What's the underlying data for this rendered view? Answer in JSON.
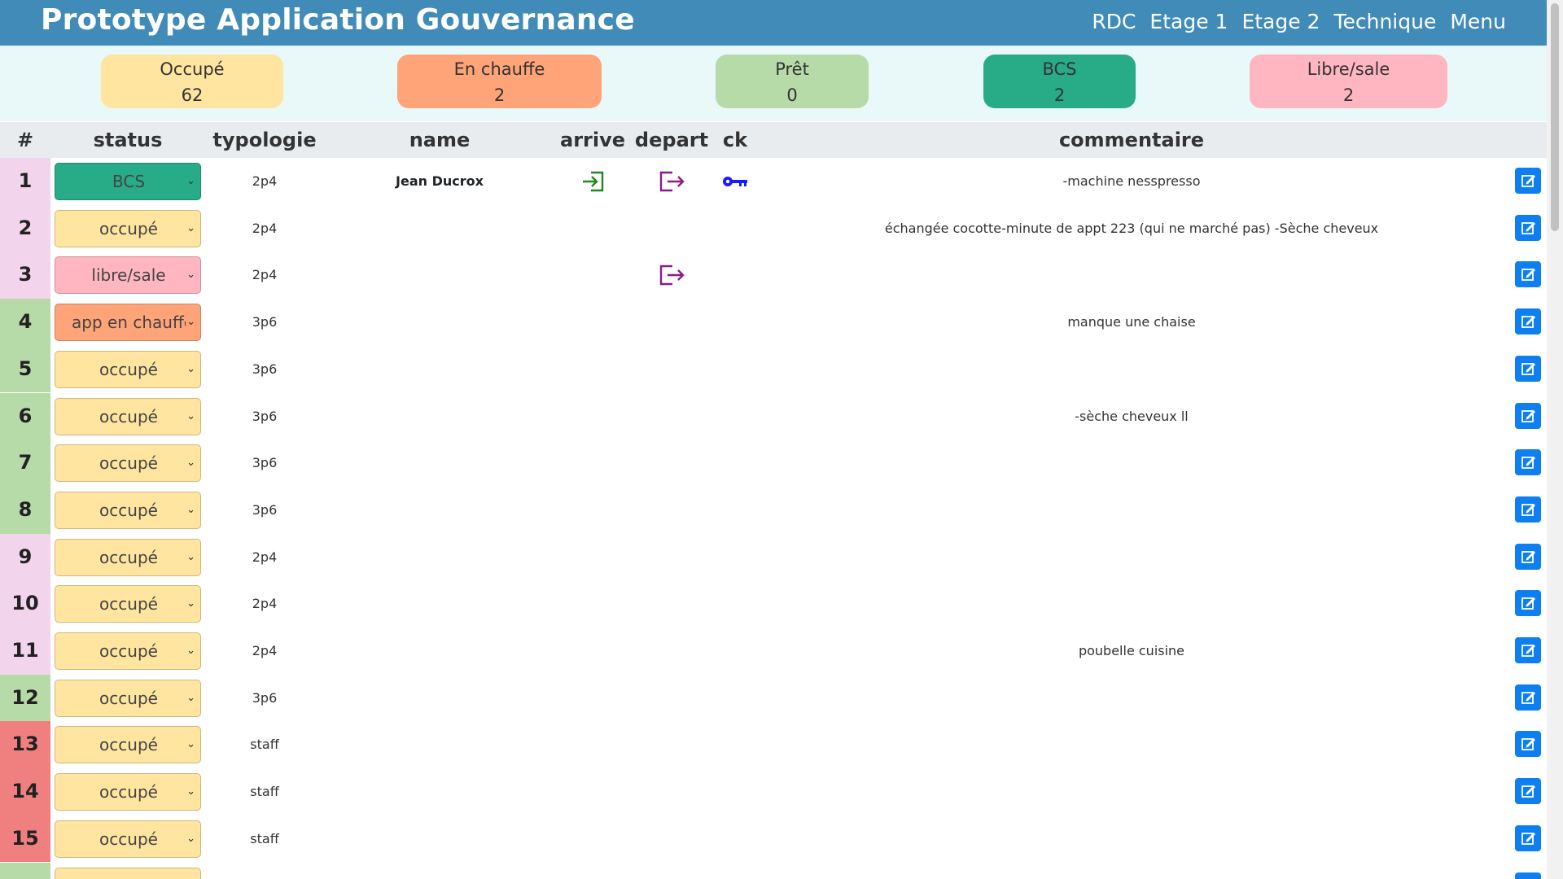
{
  "app": {
    "title": "Prototype Application Gouvernance",
    "nav": [
      "RDC",
      "Etage 1",
      "Etage 2",
      "Technique",
      "Menu"
    ]
  },
  "stats": [
    {
      "label": "Occupé",
      "count": "62",
      "color": "#ffe59f"
    },
    {
      "label": "En chauffe",
      "count": "2",
      "color": "#ffa379"
    },
    {
      "label": "Prêt",
      "count": "0",
      "color": "#b6dba8"
    },
    {
      "label": "BCS",
      "count": "2",
      "color": "#28ab87"
    },
    {
      "label": "Libre/sale",
      "count": "2",
      "color": "#ffb6c1"
    }
  ],
  "table": {
    "headers": {
      "num": "#",
      "status": "status",
      "typologie": "typologie",
      "name": "name",
      "arrive": "arrive",
      "depart": "depart",
      "ck": "ck",
      "commentaire": "commentaire"
    },
    "rows": [
      {
        "num": "1",
        "status": "BCS",
        "typologie": "2p4",
        "name": "Jean Ducrox",
        "arrive": true,
        "depart": true,
        "ck": true,
        "commentaire": "-machine nesspresso",
        "num_color": "#f2d4ec",
        "status_color": "#28ab87"
      },
      {
        "num": "2",
        "status": "occupé",
        "typologie": "2p4",
        "name": "",
        "arrive": false,
        "depart": false,
        "ck": false,
        "commentaire": "échangée cocotte-minute de appt 223 (qui ne marché pas) -Sèche cheveux",
        "num_color": "#f2d4ec",
        "status_color": "#ffe59f"
      },
      {
        "num": "3",
        "status": "libre/sale",
        "typologie": "2p4",
        "name": "",
        "arrive": false,
        "depart": true,
        "ck": false,
        "commentaire": "",
        "num_color": "#f2d4ec",
        "status_color": "#ffb6c1"
      },
      {
        "num": "4",
        "status": "app en chauffe",
        "typologie": "3p6",
        "name": "",
        "arrive": false,
        "depart": false,
        "ck": false,
        "commentaire": "manque une chaise",
        "num_color": "#b6dba8",
        "status_color": "#ffa379"
      },
      {
        "num": "5",
        "status": "occupé",
        "typologie": "3p6",
        "name": "",
        "arrive": false,
        "depart": false,
        "ck": false,
        "commentaire": "",
        "num_color": "#b6dba8",
        "status_color": "#ffe59f"
      },
      {
        "num": "6",
        "status": "occupé",
        "typologie": "3p6",
        "name": "",
        "arrive": false,
        "depart": false,
        "ck": false,
        "commentaire": "-sèche cheveux ll",
        "num_color": "#b6dba8",
        "status_color": "#ffe59f"
      },
      {
        "num": "7",
        "status": "occupé",
        "typologie": "3p6",
        "name": "",
        "arrive": false,
        "depart": false,
        "ck": false,
        "commentaire": "",
        "num_color": "#b6dba8",
        "status_color": "#ffe59f"
      },
      {
        "num": "8",
        "status": "occupé",
        "typologie": "3p6",
        "name": "",
        "arrive": false,
        "depart": false,
        "ck": false,
        "commentaire": "",
        "num_color": "#b6dba8",
        "status_color": "#ffe59f"
      },
      {
        "num": "9",
        "status": "occupé",
        "typologie": "2p4",
        "name": "",
        "arrive": false,
        "depart": false,
        "ck": false,
        "commentaire": "",
        "num_color": "#f2d4ec",
        "status_color": "#ffe59f"
      },
      {
        "num": "10",
        "status": "occupé",
        "typologie": "2p4",
        "name": "",
        "arrive": false,
        "depart": false,
        "ck": false,
        "commentaire": "",
        "num_color": "#f2d4ec",
        "status_color": "#ffe59f"
      },
      {
        "num": "11",
        "status": "occupé",
        "typologie": "2p4",
        "name": "",
        "arrive": false,
        "depart": false,
        "ck": false,
        "commentaire": "poubelle cuisine",
        "num_color": "#f2d4ec",
        "status_color": "#ffe59f"
      },
      {
        "num": "12",
        "status": "occupé",
        "typologie": "3p6",
        "name": "",
        "arrive": false,
        "depart": false,
        "ck": false,
        "commentaire": "",
        "num_color": "#b6dba8",
        "status_color": "#ffe59f"
      },
      {
        "num": "13",
        "status": "occupé",
        "typologie": "staff",
        "name": "",
        "arrive": false,
        "depart": false,
        "ck": false,
        "commentaire": "",
        "num_color": "#f08080",
        "status_color": "#ffe59f"
      },
      {
        "num": "14",
        "status": "occupé",
        "typologie": "staff",
        "name": "",
        "arrive": false,
        "depart": false,
        "ck": false,
        "commentaire": "",
        "num_color": "#f08080",
        "status_color": "#ffe59f"
      },
      {
        "num": "15",
        "status": "occupé",
        "typologie": "staff",
        "name": "",
        "arrive": false,
        "depart": false,
        "ck": false,
        "commentaire": "",
        "num_color": "#f08080",
        "status_color": "#ffe59f"
      },
      {
        "num": "",
        "status": "",
        "typologie": "",
        "name": "",
        "arrive": false,
        "depart": false,
        "ck": false,
        "commentaire": "",
        "num_color": "#b6dba8",
        "status_color": "#ffe59f"
      }
    ]
  },
  "icons": {
    "arrive": "login-arrow-icon",
    "depart": "logout-arrow-icon",
    "ck": "key-icon",
    "edit": "edit-icon",
    "arrive_color": "#1e8a1e",
    "depart_color": "#8b1a8b",
    "ck_color": "#1a1aff"
  }
}
